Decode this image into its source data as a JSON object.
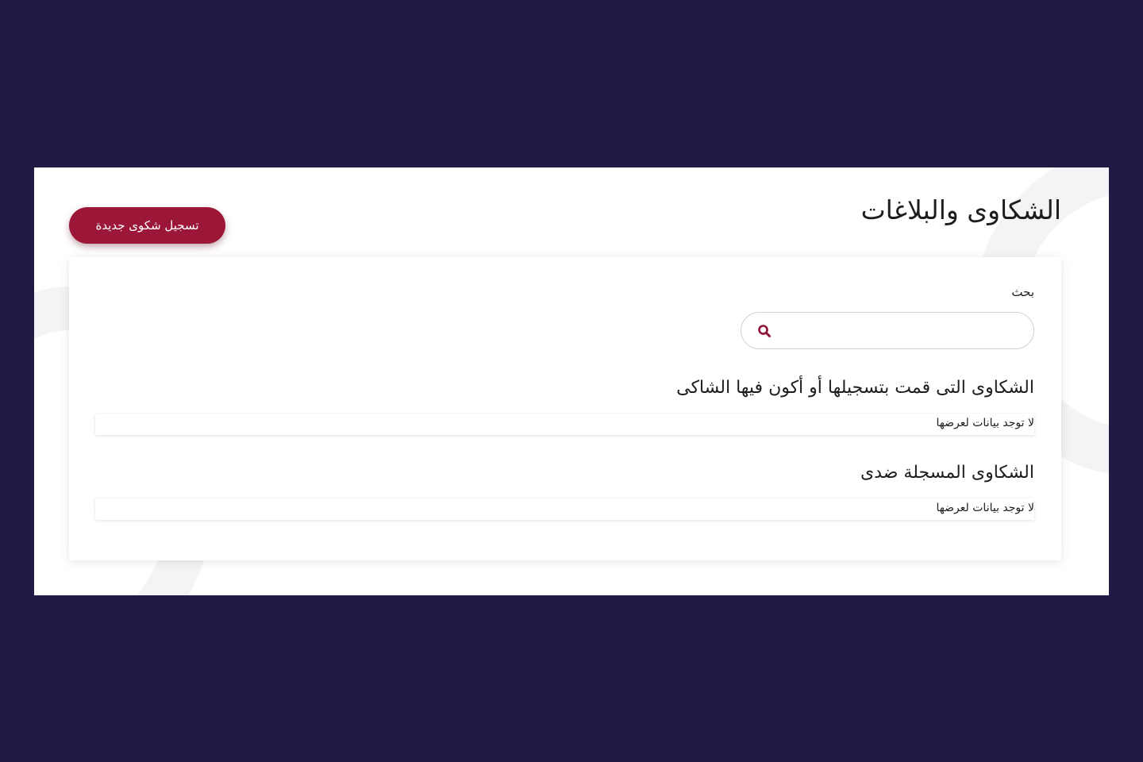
{
  "header": {
    "title": "الشكاوى والبلاغات",
    "new_complaint_label": "تسجيل شكوى جديدة"
  },
  "search": {
    "label": "بحث",
    "value": "",
    "placeholder": ""
  },
  "sections": [
    {
      "title": "الشكاوى التى قمت بتسجيلها أو أكون فيها الشاكى",
      "empty_text": "لا توجد بيانات لعرضها"
    },
    {
      "title": "الشكاوى المسجلة ضدى",
      "empty_text": "لا توجد بيانات لعرضها"
    }
  ],
  "colors": {
    "backdrop": "#221944",
    "accent": "#9b1637",
    "search_icon": "#8e1538"
  },
  "icons": {
    "search": "search-icon"
  }
}
